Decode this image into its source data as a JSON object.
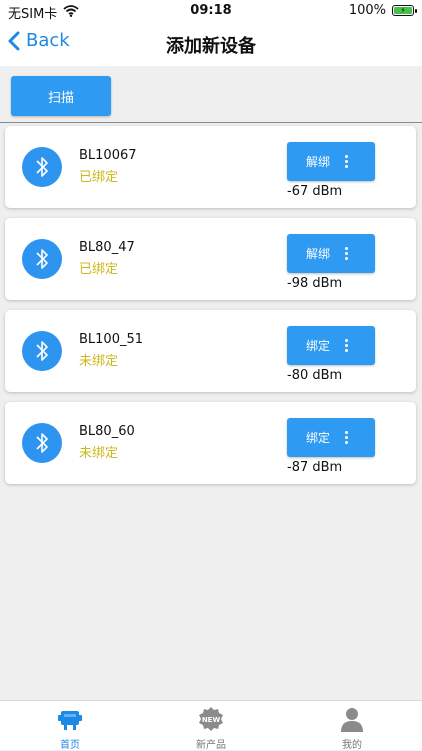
{
  "status_bar": {
    "carrier": "无SIM卡",
    "time": "09:18",
    "battery": "100%"
  },
  "nav": {
    "back_label": "Back",
    "title": "添加新设备"
  },
  "scan_label": "扫描",
  "devices": [
    {
      "name": "BL10067",
      "status": "已绑定",
      "action": "解绑",
      "rssi": "-67 dBm"
    },
    {
      "name": "BL80_47",
      "status": "已绑定",
      "action": "解绑",
      "rssi": "-98 dBm"
    },
    {
      "name": "BL100_51",
      "status": "未绑定",
      "action": "绑定",
      "rssi": "-80 dBm"
    },
    {
      "name": "BL80_60",
      "status": "未绑定",
      "action": "绑定",
      "rssi": "-87 dBm"
    }
  ],
  "tabs": [
    {
      "label": "首页",
      "icon": "home-icon",
      "active": true
    },
    {
      "label": "新产品",
      "icon": "new-badge-icon",
      "badge": "NEW",
      "active": false
    },
    {
      "label": "我的",
      "icon": "profile-icon",
      "active": false
    }
  ],
  "colors": {
    "accent": "#2f9af2",
    "status_text": "#cdb81a",
    "background": "#efefef",
    "tab_active": "#1e88e5"
  }
}
